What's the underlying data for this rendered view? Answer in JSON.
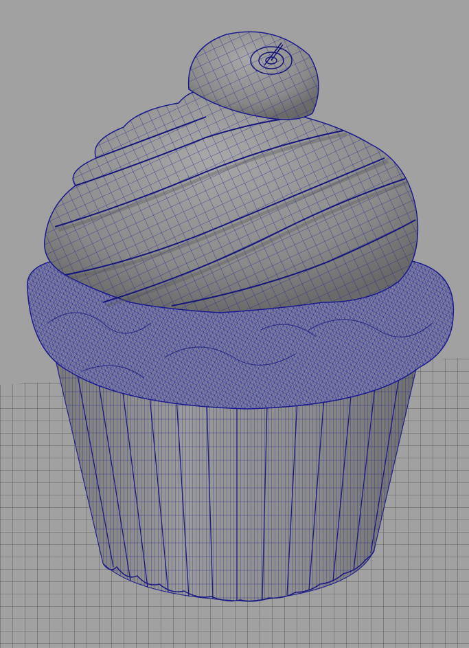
{
  "viewport": {
    "background": "#a1a1a1",
    "mode": "wireframe-on-shaded",
    "wire_color": "#1a1a8c",
    "shade_color": "#8e8e8e",
    "grid_color": "#505050"
  },
  "scene": {
    "model": "cupcake",
    "parts": [
      "frosting-swirl",
      "cake-top",
      "paper-liner",
      "ground-grid"
    ]
  }
}
